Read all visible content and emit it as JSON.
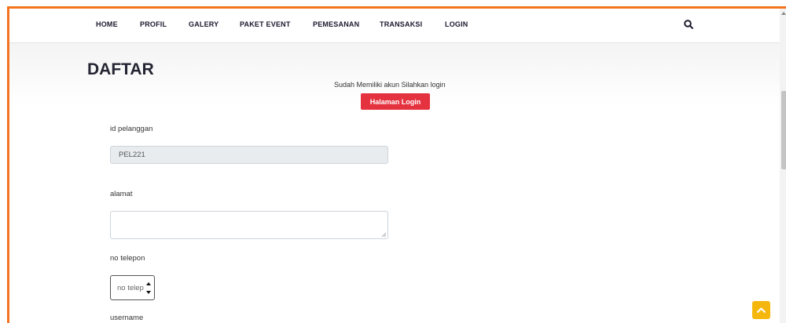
{
  "nav": {
    "items": [
      {
        "label": "HOME"
      },
      {
        "label": "PROFIL"
      },
      {
        "label": "GALERY"
      },
      {
        "label": "PAKET EVENT"
      },
      {
        "label": "PEMESANAN"
      },
      {
        "label": "TRANSAKSI"
      },
      {
        "label": "LOGIN"
      }
    ],
    "search_icon": "search-icon"
  },
  "page": {
    "title": "DAFTAR",
    "login_hint": "Sudah Memiliki akun Silahkan login",
    "login_button": "Halaman Login"
  },
  "form": {
    "id_label": "id pelanggan",
    "id_value": "PEL221",
    "alamat_label": "alamat",
    "alamat_value": "",
    "phone_label": "no telepon",
    "phone_placeholder": "no telepon",
    "username_label": "username"
  },
  "colors": {
    "accent_border": "#f5731e",
    "login_button": "#e5323f",
    "scroll_top_button": "#f5b70d"
  }
}
